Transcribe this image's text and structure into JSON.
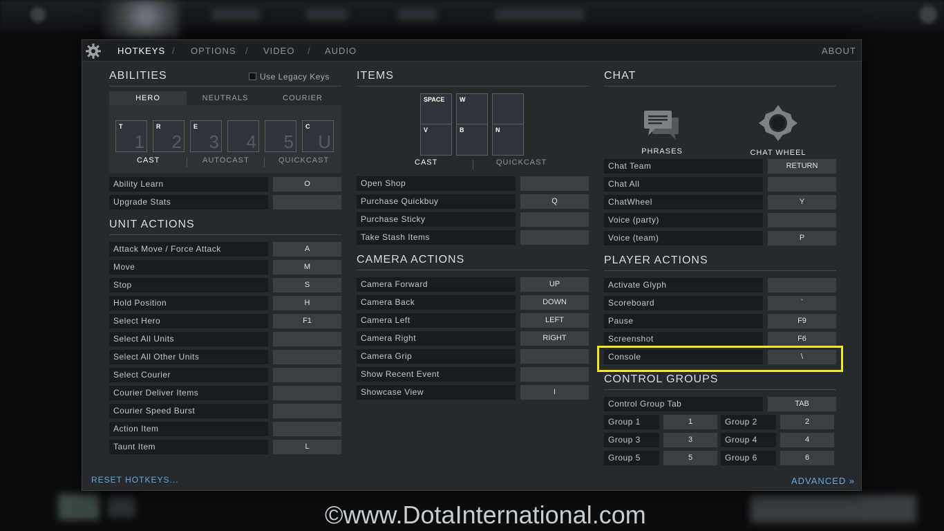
{
  "tabs": [
    {
      "label": "HOTKEYS",
      "active": true
    },
    {
      "label": "OPTIONS"
    },
    {
      "label": "VIDEO"
    },
    {
      "label": "AUDIO"
    }
  ],
  "about_label": "ABOUT",
  "abilities": {
    "title": "ABILITIES",
    "legacy_keys_label": "Use Legacy Keys",
    "subtabs": [
      "HERO",
      "NEUTRALS",
      "COURIER"
    ],
    "slots": [
      {
        "hotkey": "T",
        "number": "1"
      },
      {
        "hotkey": "R",
        "number": "2"
      },
      {
        "hotkey": "E",
        "number": "3"
      },
      {
        "hotkey": "",
        "number": "4"
      },
      {
        "hotkey": "",
        "number": "5"
      },
      {
        "hotkey": "C",
        "number": "U"
      }
    ],
    "cast_options": [
      "CAST",
      "AUTOCAST",
      "QUICKCAST"
    ],
    "rows": [
      {
        "label": "Ability Learn",
        "key": "O"
      },
      {
        "label": "Upgrade Stats",
        "key": ""
      }
    ]
  },
  "unit_actions": {
    "title": "UNIT ACTIONS",
    "rows": [
      {
        "label": "Attack Move / Force Attack",
        "key": "A"
      },
      {
        "label": "Move",
        "key": "M"
      },
      {
        "label": "Stop",
        "key": "S"
      },
      {
        "label": "Hold Position",
        "key": "H"
      },
      {
        "label": "Select Hero",
        "key": "F1"
      },
      {
        "label": "Select All Units",
        "key": ""
      },
      {
        "label": "Select All Other Units",
        "key": ""
      },
      {
        "label": "Select Courier",
        "key": ""
      },
      {
        "label": "Courier Deliver Items",
        "key": ""
      },
      {
        "label": "Courier Speed Burst",
        "key": ""
      },
      {
        "label": "Action Item",
        "key": ""
      },
      {
        "label": "Taunt Item",
        "key": "L"
      }
    ]
  },
  "items": {
    "title": "ITEMS",
    "slots": [
      "SPACE",
      "W",
      "",
      "V",
      "B",
      "N"
    ],
    "cast_options": [
      "CAST",
      "QUICKCAST"
    ],
    "rows": [
      {
        "label": "Open Shop",
        "key": ""
      },
      {
        "label": "Purchase Quickbuy",
        "key": "Q"
      },
      {
        "label": "Purchase Sticky",
        "key": ""
      },
      {
        "label": "Take Stash Items",
        "key": ""
      }
    ]
  },
  "camera_actions": {
    "title": "CAMERA ACTIONS",
    "rows": [
      {
        "label": "Camera Forward",
        "key": "UP"
      },
      {
        "label": "Camera Back",
        "key": "DOWN"
      },
      {
        "label": "Camera Left",
        "key": "LEFT"
      },
      {
        "label": "Camera Right",
        "key": "RIGHT"
      },
      {
        "label": "Camera Grip",
        "key": ""
      },
      {
        "label": "Show Recent Event",
        "key": ""
      },
      {
        "label": "Showcase View",
        "key": "I"
      }
    ]
  },
  "chat": {
    "title": "CHAT",
    "phrases_label": "PHRASES",
    "chat_wheel_label": "CHAT WHEEL",
    "rows": [
      {
        "label": "Chat Team",
        "key": "RETURN"
      },
      {
        "label": "Chat All",
        "key": ""
      },
      {
        "label": "ChatWheel",
        "key": "Y"
      },
      {
        "label": "Voice (party)",
        "key": ""
      },
      {
        "label": "Voice (team)",
        "key": "P"
      }
    ]
  },
  "player_actions": {
    "title": "PLAYER ACTIONS",
    "rows": [
      {
        "label": "Activate Glyph",
        "key": ""
      },
      {
        "label": "Scoreboard",
        "key": "`"
      },
      {
        "label": "Pause",
        "key": "F9"
      },
      {
        "label": "Screenshot",
        "key": "F6"
      },
      {
        "label": "Console",
        "key": "\\"
      }
    ]
  },
  "control_groups": {
    "title": "CONTROL GROUPS",
    "tab_row": {
      "label": "Control Group Tab",
      "key": "TAB"
    },
    "groups": [
      {
        "label": "Group 1",
        "key": "1"
      },
      {
        "label": "Group 2",
        "key": "2"
      },
      {
        "label": "Group 3",
        "key": "3"
      },
      {
        "label": "Group 4",
        "key": "4"
      },
      {
        "label": "Group 5",
        "key": "5"
      },
      {
        "label": "Group 6",
        "key": "6"
      }
    ]
  },
  "footer": {
    "reset_label": "RESET HOTKEYS...",
    "advanced_label": "ADVANCED »"
  },
  "watermark": "©www.DotaInternational.com",
  "colors": {
    "highlight": "#f4e81f",
    "link": "#6aa9d8"
  }
}
